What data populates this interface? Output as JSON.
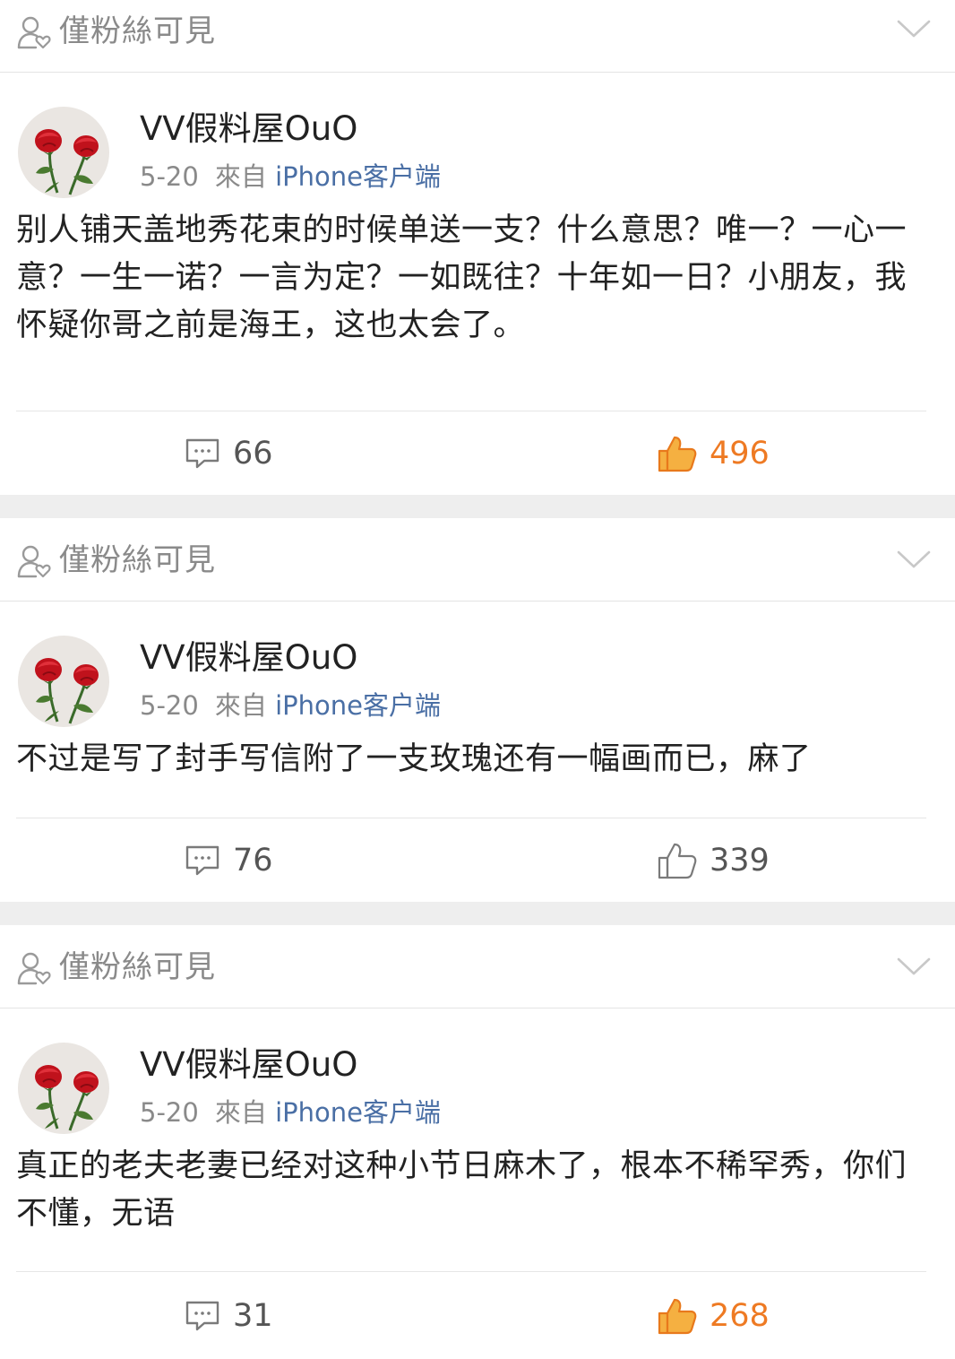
{
  "colors": {
    "like_active": "#ee7a23",
    "meta_link": "#4a6fa5",
    "muted": "#8a8a8a",
    "divider_band": "#eeeeee"
  },
  "posts": [
    {
      "visibility_label": "僅粉絲可見",
      "author": "VV假料屋OuO",
      "date": "5-20",
      "source_prefix": "來自",
      "source_client": "iPhone客户端",
      "text": "别人铺天盖地秀花束的时候单送一支？什么意思？唯一？一心一意？一生一诺？一言为定？一如既往？十年如一日？小朋友，我怀疑你哥之前是海王，这也太会了。",
      "comments": "66",
      "likes": "496",
      "liked": true,
      "icons": [
        "person-heart-icon",
        "chevron-down-icon",
        "comment-icon",
        "thumbs-up-icon"
      ]
    },
    {
      "visibility_label": "僅粉絲可見",
      "author": "VV假料屋OuO",
      "date": "5-20",
      "source_prefix": "來自",
      "source_client": "iPhone客户端",
      "text": "不过是写了封手写信附了一支玫瑰还有一幅画而已，麻了",
      "comments": "76",
      "likes": "339",
      "liked": false,
      "icons": [
        "person-heart-icon",
        "chevron-down-icon",
        "comment-icon",
        "thumbs-up-icon"
      ]
    },
    {
      "visibility_label": "僅粉絲可見",
      "author": "VV假料屋OuO",
      "date": "5-20",
      "source_prefix": "來自",
      "source_client": "iPhone客户端",
      "text": "真正的老夫老妻已经对这种小节日麻木了，根本不稀罕秀，你们不懂，无语",
      "comments": "31",
      "likes": "268",
      "liked": true,
      "icons": [
        "person-heart-icon",
        "chevron-down-icon",
        "comment-icon",
        "thumbs-up-icon"
      ]
    }
  ]
}
